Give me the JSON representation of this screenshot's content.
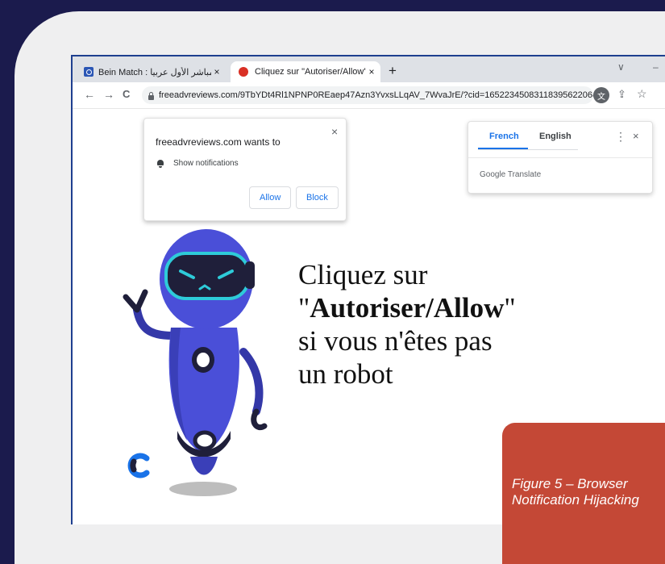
{
  "tabs": [
    {
      "title": "Bein Match : بث المباشر الأول عربيا",
      "close": "×",
      "active": false
    },
    {
      "title": "Cliquez sur \"Autoriser/Allow\"",
      "close": "×",
      "active": true
    }
  ],
  "new_tab_label": "+",
  "window_controls": {
    "dropdown": "∨",
    "minimize": "–"
  },
  "nav": {
    "back": "←",
    "forward": "→",
    "reload": "C"
  },
  "address": {
    "url": "freeadvreviews.com/9TbYDt4Rl1NPNP0REaep47Azn3YvxsLLqAV_7WvaJrE/?cid=16522345083118395622068..."
  },
  "toolbar_icons": {
    "translate": "文",
    "share": "⇪",
    "star": "☆"
  },
  "notification": {
    "title": "freeadvreviews.com wants to",
    "close": "×",
    "permission": "Show notifications",
    "allow": "Allow",
    "block": "Block"
  },
  "translate": {
    "source_lang": "French",
    "target_lang": "English",
    "more": "⋮",
    "close": "×",
    "provider": "Google Translate"
  },
  "page": {
    "line1": "Cliquez sur",
    "line2_open": "\"",
    "line2_bold": "Autoriser/Allow",
    "line2_close": "\"",
    "line3": "si vous n'êtes pas",
    "line4": "un robot"
  },
  "caption": {
    "line1": "Figure 5 – Browser",
    "line2": "Notification Hijacking"
  },
  "colors": {
    "outer_bg": "#1b1b4d",
    "slide_bg": "#efeff0",
    "caption_bg": "#c44836",
    "robot_blue": "#4a4fd8",
    "visor": "#2ecbd9",
    "accent_link": "#1a73e8"
  }
}
